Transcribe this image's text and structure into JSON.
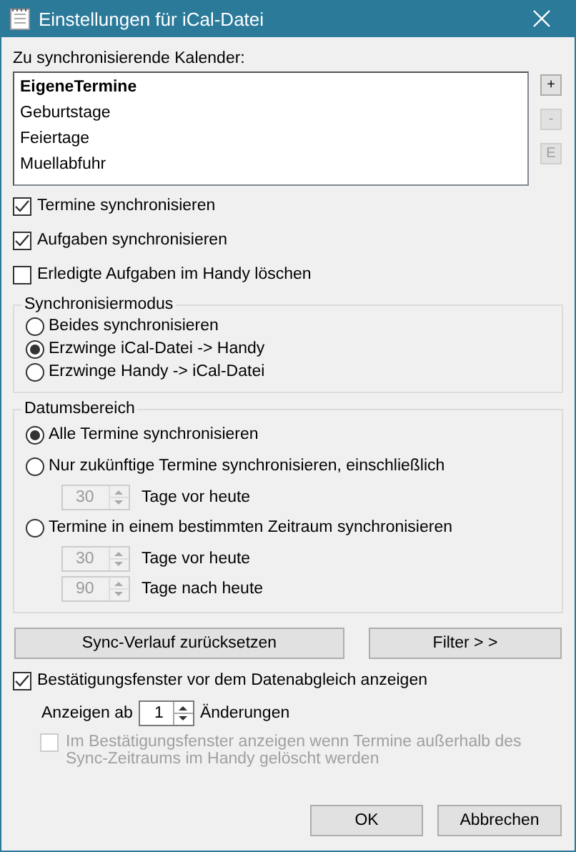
{
  "window": {
    "title": "Einstellungen für iCal-Datei"
  },
  "calendars": {
    "label": "Zu synchronisierende Kalender:",
    "items": [
      {
        "name": "EigeneTermine",
        "bold": true
      },
      {
        "name": "Geburtstage",
        "bold": false
      },
      {
        "name": "Feiertage",
        "bold": false
      },
      {
        "name": "Muellabfuhr",
        "bold": false
      }
    ],
    "buttons": [
      {
        "label": "+",
        "disabled": false
      },
      {
        "label": "-",
        "disabled": true
      },
      {
        "label": "E",
        "disabled": true
      }
    ]
  },
  "options": [
    {
      "label": "Termine synchronisieren",
      "checked": true
    },
    {
      "label": "Aufgaben synchronisieren",
      "checked": true
    },
    {
      "label": "Erledigte Aufgaben im Handy löschen",
      "checked": false
    }
  ],
  "sync_mode": {
    "title": "Synchronisiermodus",
    "options": [
      {
        "label": "Beides synchronisieren",
        "selected": false
      },
      {
        "label": "Erzwinge iCal-Datei -> Handy",
        "selected": true
      },
      {
        "label": "Erzwinge Handy -> iCal-Datei",
        "selected": false
      }
    ]
  },
  "date_range": {
    "title": "Datumsbereich",
    "options": [
      {
        "label": "Alle Termine synchronisieren",
        "selected": true
      },
      {
        "label": "Nur zukünftige Termine synchronisieren, einschließlich",
        "selected": false,
        "spinners": [
          {
            "value": "30",
            "label": "Tage vor heute",
            "disabled": true
          }
        ]
      },
      {
        "label": "Termine in einem bestimmten Zeitraum synchronisieren",
        "selected": false,
        "spinners": [
          {
            "value": "30",
            "label": "Tage vor heute",
            "disabled": true
          },
          {
            "value": "90",
            "label": "Tage nach heute",
            "disabled": true
          }
        ]
      }
    ]
  },
  "action_buttons": [
    "Sync-Verlauf zurücksetzen",
    "Filter > >"
  ],
  "confirm": {
    "label": "Bestätigungsfenster vor dem Datenabgleich anzeigen",
    "checked": true,
    "threshold": {
      "prefix": "Anzeigen ab",
      "value": "1",
      "suffix": "Änderungen",
      "disabled": false
    },
    "sub_option": {
      "label": "Im Bestätigungsfenster anzeigen wenn Termine außerhalb des Sync-Zeitraums im Handy gelöscht werden",
      "checked": false,
      "disabled": true
    }
  },
  "footer_buttons": [
    "OK",
    "Abbrechen"
  ]
}
